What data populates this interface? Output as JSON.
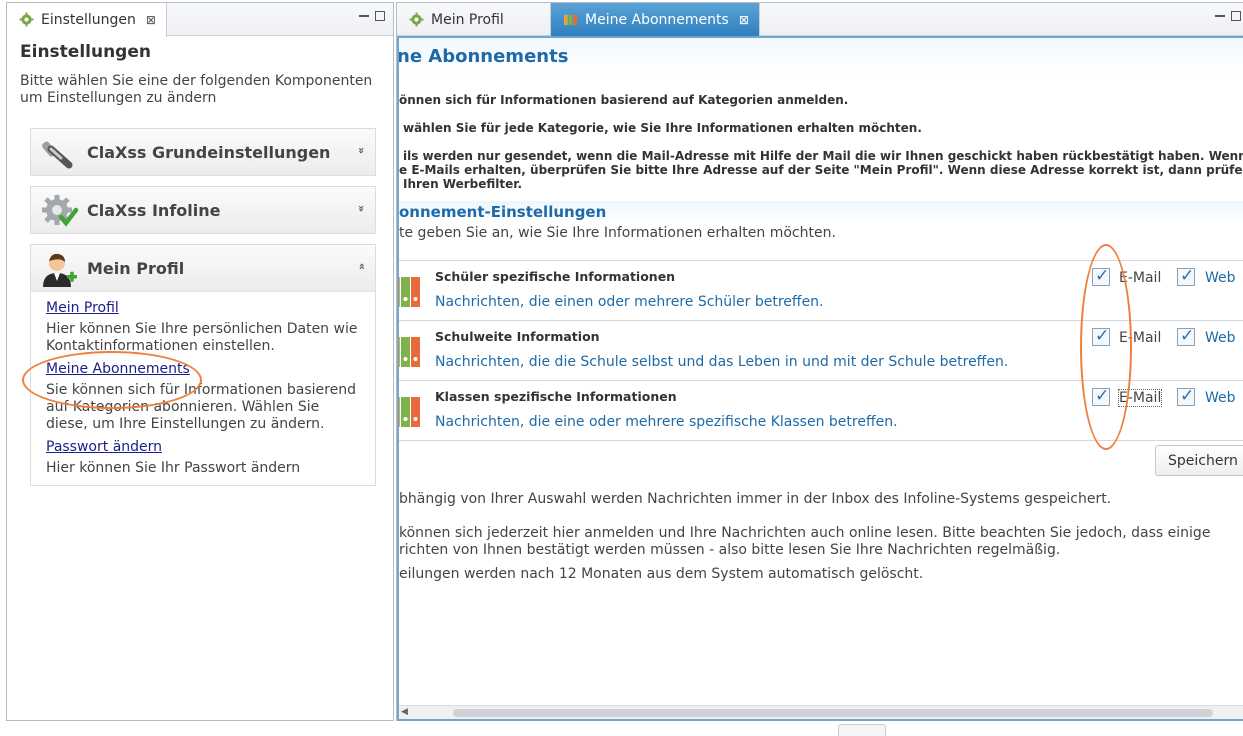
{
  "left_tab": {
    "label": "Einstellungen",
    "close": "⊠"
  },
  "left": {
    "title": "Einstellungen",
    "description": "Bitte wählen Sie eine der folgenden Komponenten um Einstellungen zu ändern",
    "sections": [
      {
        "label": "ClaXss Grundeinstellungen",
        "icon": "wrench-icon",
        "chevron": "»"
      },
      {
        "label": "ClaXss Infoline",
        "icon": "gear-check-icon",
        "chevron": "»"
      },
      {
        "label": "Mein Profil",
        "icon": "user-add-icon",
        "chevron": "»"
      }
    ],
    "profile_items": [
      {
        "link": "Mein Profil",
        "text": "Hier können Sie Ihre persönlichen Daten wie Kontaktinformationen einstellen."
      },
      {
        "link": "Meine Abonnements",
        "text": "Sie können sich für Informationen basierend auf Kategorien abonnieren. Wählen Sie diese, um Ihre Einstellungen zu ändern."
      },
      {
        "link": "Passwort ändern",
        "text": "Hier können Sie Ihr Passwort ändern"
      }
    ]
  },
  "right_tabs": [
    {
      "label": "Mein Profil",
      "active": false
    },
    {
      "label": "Meine Abonnements",
      "active": true,
      "close": "⊠"
    }
  ],
  "right": {
    "title": "ne Abonnements",
    "info_lines": [
      "önnen sich für Informationen basierend auf Kategorien anmelden.",
      "wählen Sie für jede Kategorie, wie Sie Ihre Informationen erhalten möchten.",
      "ils werden nur gesendet, wenn die Mail-Adresse mit Hilfe der Mail die wir Ihnen geschickt haben rückbestätigt haben. Wenn Sie",
      "e E-Mails erhalten, überprüfen Sie bitte Ihre Adresse auf der Seite \"Mein Profil\". Wenn diese Adresse korrekt ist, dann prüfen Sie",
      "Ihren Werbefilter."
    ],
    "section_title": "onnement-Einstellungen",
    "section_desc": "te geben Sie an, wie Sie Ihre Informationen erhalten möchten.",
    "categories": [
      {
        "name": "Schüler spezifische Informationen",
        "desc": "Nachrichten, die einen oder mehrere Schüler betreffen.",
        "email_label": "E-Mail",
        "web_label": "Web",
        "email": true,
        "web": true
      },
      {
        "name": "Schulweite Information",
        "desc": "Nachrichten, die die Schule selbst und das Leben in und mit der Schule betreffen.",
        "email_label": "E-Mail",
        "web_label": "Web",
        "email": true,
        "web": true
      },
      {
        "name": "Klassen spezifische Informationen",
        "desc": "Nachrichten, die eine oder mehrere spezifische Klassen betreffen.",
        "email_label": "E-Mail",
        "web_label": "Web",
        "email": true,
        "web": true
      }
    ],
    "save_label": "Speichern",
    "footer_lines": [
      "bhängig von Ihrer Auswahl werden Nachrichten immer in der Inbox des Infoline-Systems gespeichert.",
      "können sich jederzeit hier anmelden und Ihre Nachrichten auch online lesen. Bitte beachten Sie jedoch, dass einige",
      "richten von Ihnen bestätigt werden müssen - also bitte lesen Sie Ihre Nachrichten regelmäßig.",
      "eilungen werden nach 12 Monaten aus dem System automatisch gelöscht."
    ]
  },
  "colors": {
    "accent": "#1e6aa8",
    "tab_active": "#2f7fbf",
    "annotation": "#f07f3c",
    "link": "#1d1d8a"
  }
}
